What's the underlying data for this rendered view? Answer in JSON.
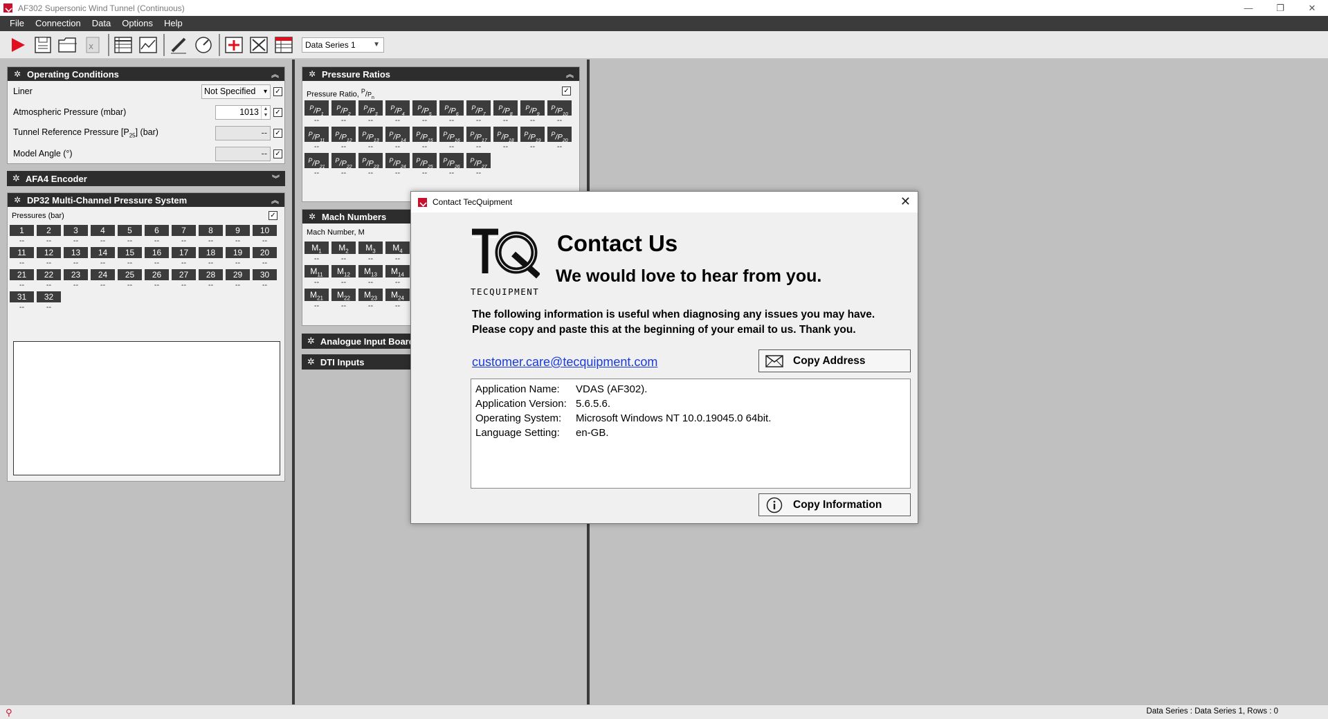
{
  "window": {
    "title": "AF302 Supersonic Wind Tunnel (Continuous)"
  },
  "menu": [
    "File",
    "Connection",
    "Data",
    "Options",
    "Help"
  ],
  "toolbar": {
    "series_selected": "Data Series 1"
  },
  "operating_conditions": {
    "title": "Operating Conditions",
    "rows": [
      {
        "label": "Liner",
        "value": "Not Specified"
      },
      {
        "label": "Atmospheric Pressure  (mbar)",
        "value": "1013"
      },
      {
        "label": "Tunnel Reference Pressure [P",
        "sub": "25",
        "tail": "] (bar)",
        "value": "--"
      },
      {
        "label": "Model Angle  (°)",
        "value": "--"
      }
    ]
  },
  "afa4": {
    "title": "AFA4 Encoder"
  },
  "dp32": {
    "title": "DP32 Multi-Channel Pressure System",
    "label": "Pressures (bar)",
    "channels": [
      "1",
      "2",
      "3",
      "4",
      "5",
      "6",
      "7",
      "8",
      "9",
      "10",
      "11",
      "12",
      "13",
      "14",
      "15",
      "16",
      "17",
      "18",
      "19",
      "20",
      "21",
      "22",
      "23",
      "24",
      "25",
      "26",
      "27",
      "28",
      "29",
      "30",
      "31",
      "32"
    ],
    "empty_value": "--"
  },
  "pressure_ratios": {
    "title": "Pressure Ratios",
    "label_prefix": "Pressure Ratio,",
    "ratio_top": "P",
    "ratio_bottom": "P",
    "ratio_bottom_sub": "n",
    "count": 27,
    "empty_value": "--"
  },
  "mach_numbers": {
    "title": "Mach Numbers",
    "label": "Mach Number, M",
    "visible": [
      "M1",
      "M2",
      "M3",
      "M4",
      "M11",
      "M12",
      "M13",
      "M14",
      "M21",
      "M22",
      "M23",
      "M24"
    ],
    "empty_value": "--"
  },
  "analogue": {
    "title": "Analogue Input Board"
  },
  "dti": {
    "title": "DTI Inputs"
  },
  "dialog": {
    "title": "Contact TecQuipment",
    "logo_text": "TECQUIPMENT",
    "heading": "Contact Us",
    "subheading": "We would love to hear from you.",
    "info_line1": "The following information is useful when diagnosing any issues you may have.",
    "info_line2": "Please copy and paste this at the beginning of your email to us. Thank you.",
    "email": "customer.care@tecquipment.com",
    "copy_address": "Copy Address",
    "copy_information": "Copy Information",
    "info": [
      {
        "key": "Application Name:",
        "value": "VDAS (AF302)."
      },
      {
        "key": "Application Version:",
        "value": "5.6.5.6."
      },
      {
        "key": "Operating System:",
        "value": "Microsoft Windows NT 10.0.19045.0 64bit."
      },
      {
        "key": "Language Setting:",
        "value": "en-GB."
      }
    ]
  },
  "status": {
    "text": "Data Series : Data Series 1,  Rows : 0"
  },
  "colors": {
    "accent": "#c8102e",
    "panel_header": "#2d2d2d",
    "link": "#1a3bdb"
  }
}
